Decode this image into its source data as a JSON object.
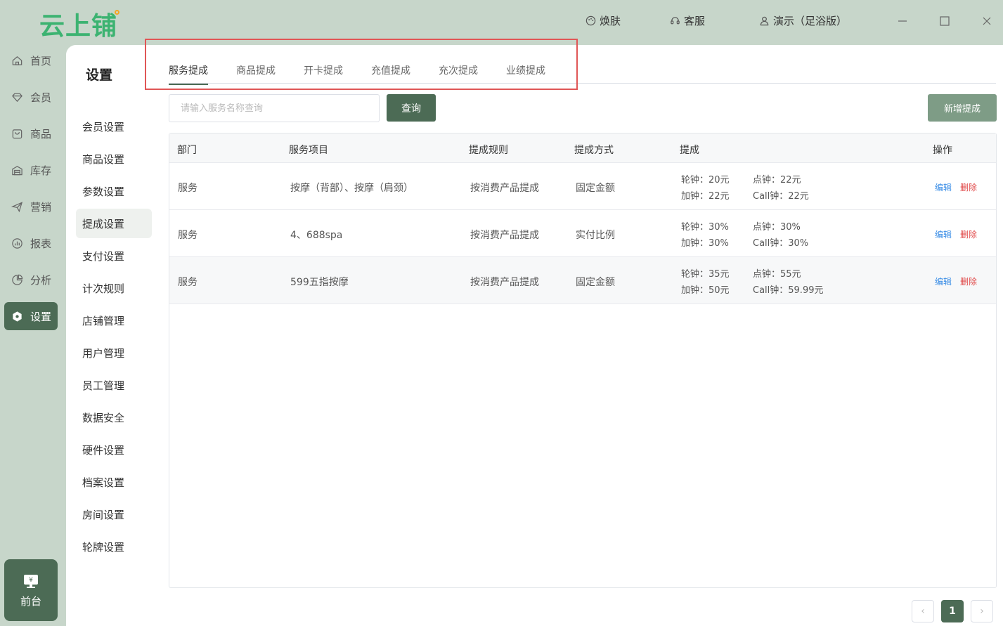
{
  "app": {
    "logo": "云上铺",
    "top": {
      "skin": "焕肤",
      "service": "客服",
      "user": "演示（足浴版）"
    }
  },
  "nav": {
    "items": [
      {
        "label": "首页",
        "icon": "home-icon"
      },
      {
        "label": "会员",
        "icon": "diamond-icon"
      },
      {
        "label": "商品",
        "icon": "bag-icon"
      },
      {
        "label": "库存",
        "icon": "warehouse-icon"
      },
      {
        "label": "营销",
        "icon": "send-icon"
      },
      {
        "label": "报表",
        "icon": "chart-icon"
      },
      {
        "label": "分析",
        "icon": "pie-icon"
      },
      {
        "label": "设置",
        "icon": "gear-icon"
      }
    ],
    "front": "前台"
  },
  "settings": {
    "title": "设置",
    "items": [
      "会员设置",
      "商品设置",
      "参数设置",
      "提成设置",
      "支付设置",
      "计次规则",
      "店铺管理",
      "用户管理",
      "员工管理",
      "数据安全",
      "硬件设置",
      "档案设置",
      "房间设置",
      "轮牌设置"
    ]
  },
  "tabs": [
    "服务提成",
    "商品提成",
    "开卡提成",
    "充值提成",
    "充次提成",
    "业绩提成"
  ],
  "search": {
    "placeholder": "请输入服务名称查询",
    "query_label": "查询",
    "add_label": "新增提成"
  },
  "table": {
    "headers": [
      "部门",
      "服务项目",
      "提成规则",
      "提成方式",
      "提成",
      "操作"
    ],
    "rows": [
      {
        "dept": "服务",
        "item": "按摩（背部）、按摩（肩颈）",
        "rule": "按消费产品提成",
        "mode": "固定金额",
        "c1": "轮钟：20元",
        "c2": "点钟：22元",
        "c3": "加钟：22元",
        "c4": "Call钟：22元"
      },
      {
        "dept": "服务",
        "item": "4、688spa",
        "rule": "按消费产品提成",
        "mode": "实付比例",
        "c1": "轮钟：30%",
        "c2": "点钟：30%",
        "c3": "加钟：30%",
        "c4": "Call钟：30%"
      },
      {
        "dept": "服务",
        "item": "599五指按摩",
        "rule": "按消费产品提成",
        "mode": "固定金额",
        "c1": "轮钟：35元",
        "c2": "点钟：55元",
        "c3": "加钟：50元",
        "c4": "Call钟：59.99元"
      }
    ],
    "edit_label": "编辑",
    "delete_label": "删除"
  },
  "pagination": {
    "prev": "‹",
    "current": "1",
    "next": "›"
  }
}
